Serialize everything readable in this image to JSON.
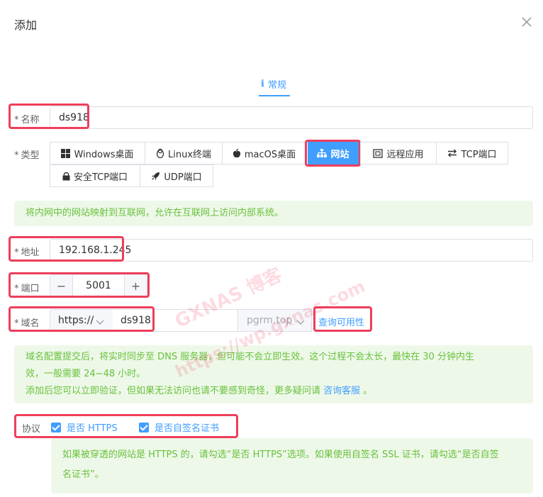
{
  "dialog": {
    "title": "添加"
  },
  "tabs": [
    {
      "icon": "info-icon",
      "label": "常规"
    }
  ],
  "form": {
    "name": {
      "label": "名称",
      "value": "ds918"
    },
    "type": {
      "label": "类型",
      "options": [
        {
          "label": "Windows桌面",
          "icon": "windows-icon"
        },
        {
          "label": "Linux终端",
          "icon": "linux-icon"
        },
        {
          "label": "macOS桌面",
          "icon": "apple-icon"
        },
        {
          "label": "网站",
          "icon": "sitemap-icon",
          "active": true
        },
        {
          "label": "远程应用",
          "icon": "remote-app-icon"
        },
        {
          "label": "TCP端口",
          "icon": "exchange-icon"
        },
        {
          "label": "安全TCP端口",
          "icon": "lock-icon"
        },
        {
          "label": "UDP端口",
          "icon": "rocket-icon"
        }
      ],
      "tip": "将内网中的网站映射到互联网，允许在互联网上访问内部系统。"
    },
    "address": {
      "label": "地址",
      "value": "192.168.1.245"
    },
    "port": {
      "label": "端口",
      "value": "5001",
      "minus": "−",
      "plus": "+"
    },
    "domain": {
      "label": "域名",
      "protocol": "https://",
      "subdomain": "ds918",
      "suffix": "pgrm.top",
      "check_link": "查询可用性"
    },
    "domain_tip": {
      "line1": "域名配置提交后，将实时同步至 DNS 服务器，但可能不会立即生效。这个过程不会太长，最快在 30 分钟内生",
      "line2": "效，一般需要 24~48 小时。",
      "line3_prefix": "添加后您可以立即验证，但如果无法访问也请不要感到奇怪，更多疑问请 ",
      "line3_link": "咨询客服",
      "line3_suffix": " 。"
    },
    "protocol": {
      "label": "协议",
      "https_label": "是否 HTTPS",
      "https_checked": true,
      "selfsigned_label": "是否自签名证书",
      "selfsigned_checked": true
    },
    "protocol_tip": {
      "line1": "如果被穿透的网站是 HTTPS 的，请勾选“是否 HTTPS”选项。如果使用自签名 SSL 证书，请勾选“是否自签",
      "line2": "名证书”。"
    }
  },
  "watermark": {
    "line1": "GXNAS 博客",
    "line2": "https://wp.gxnas.com"
  },
  "colors": {
    "accent": "#409eff",
    "highlight": "#ee3e5b",
    "tip_bg": "#eef8e9",
    "tip_text": "#67c23a"
  }
}
